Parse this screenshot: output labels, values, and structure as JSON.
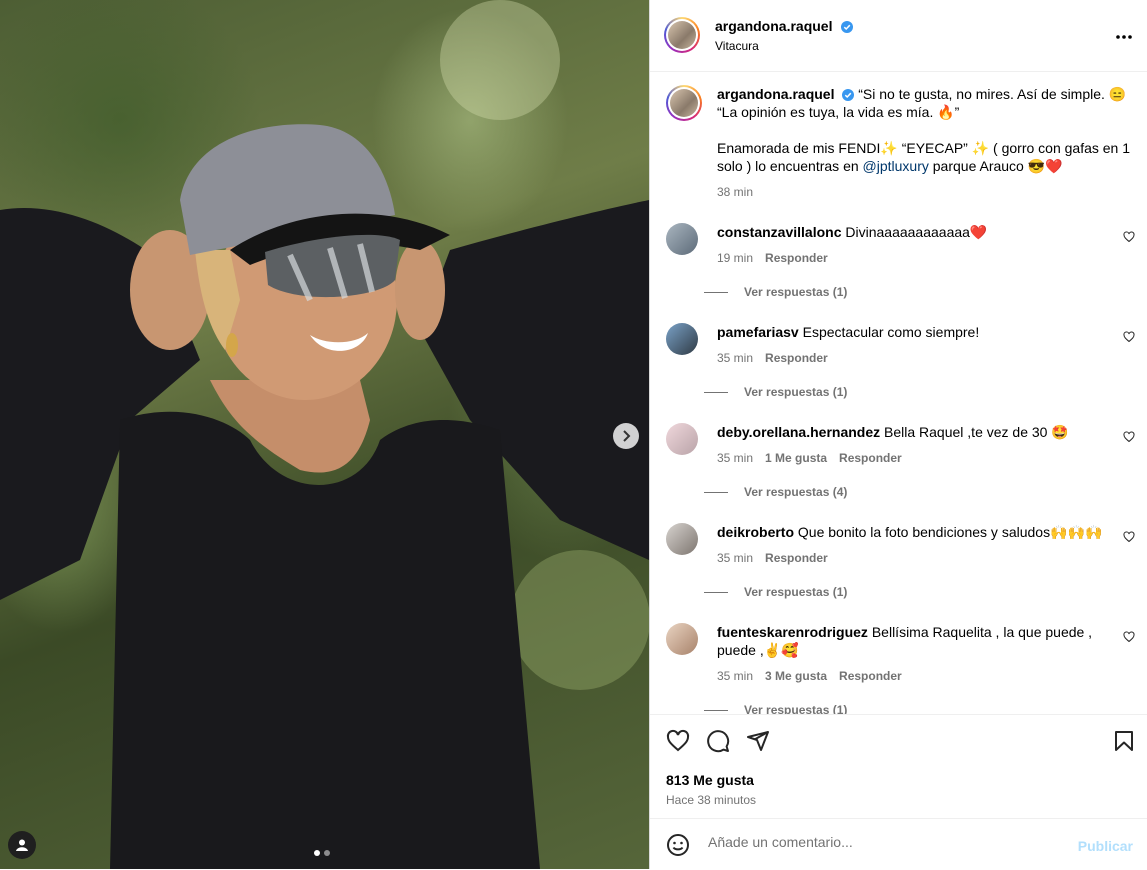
{
  "post": {
    "username": "argandona.raquel",
    "location": "Vitacura",
    "caption_line1": "“Si no te gusta, no mires. Así de simple. 😑",
    "caption_line2": "“La opinión es tuya, la vida es mía. 🔥”",
    "caption_line3a": "Enamorada de mis FENDI✨ “EYECAP” ✨ ( gorro con gafas en 1 solo ) lo encuentras en ",
    "caption_mention": "@jptluxury",
    "caption_line3b": " parque Arauco 😎❤️",
    "caption_time": "38 min",
    "likes": "813 Me gusta",
    "posted_ago": "Hace 38 minutos"
  },
  "comments": [
    {
      "user": "constanzavillalonc",
      "text": "Divinaaaaaaaaaaaa❤️",
      "time": "19 min",
      "likes": "",
      "reply": "Responder",
      "view_replies": "Ver respuestas (1)"
    },
    {
      "user": "pamefariasv",
      "text": "Espectacular como siempre!",
      "time": "35 min",
      "likes": "",
      "reply": "Responder",
      "view_replies": "Ver respuestas (1)"
    },
    {
      "user": "deby.orellana.hernandez",
      "text": "Bella Raquel ,te vez de 30 🤩",
      "time": "35 min",
      "likes": "1 Me gusta",
      "reply": "Responder",
      "view_replies": "Ver respuestas (4)"
    },
    {
      "user": "deikroberto",
      "text": "Que bonito la foto bendiciones y saludos🙌🙌🙌",
      "time": "35 min",
      "likes": "",
      "reply": "Responder",
      "view_replies": "Ver respuestas (1)"
    },
    {
      "user": "fuenteskarenrodriguez",
      "text": "Bellísima Raquelita , la que puede , puede ,✌️🥰",
      "time": "35 min",
      "likes": "3 Me gusta",
      "reply": "Responder",
      "view_replies": "Ver respuestas (1)"
    }
  ],
  "add_comment": {
    "placeholder": "Añade un comentario...",
    "publish": "Publicar"
  },
  "colors": {
    "verified": "#3897f0",
    "mention": "#00376b",
    "publish_disabled": "#b2dffc",
    "muted": "#737373"
  }
}
